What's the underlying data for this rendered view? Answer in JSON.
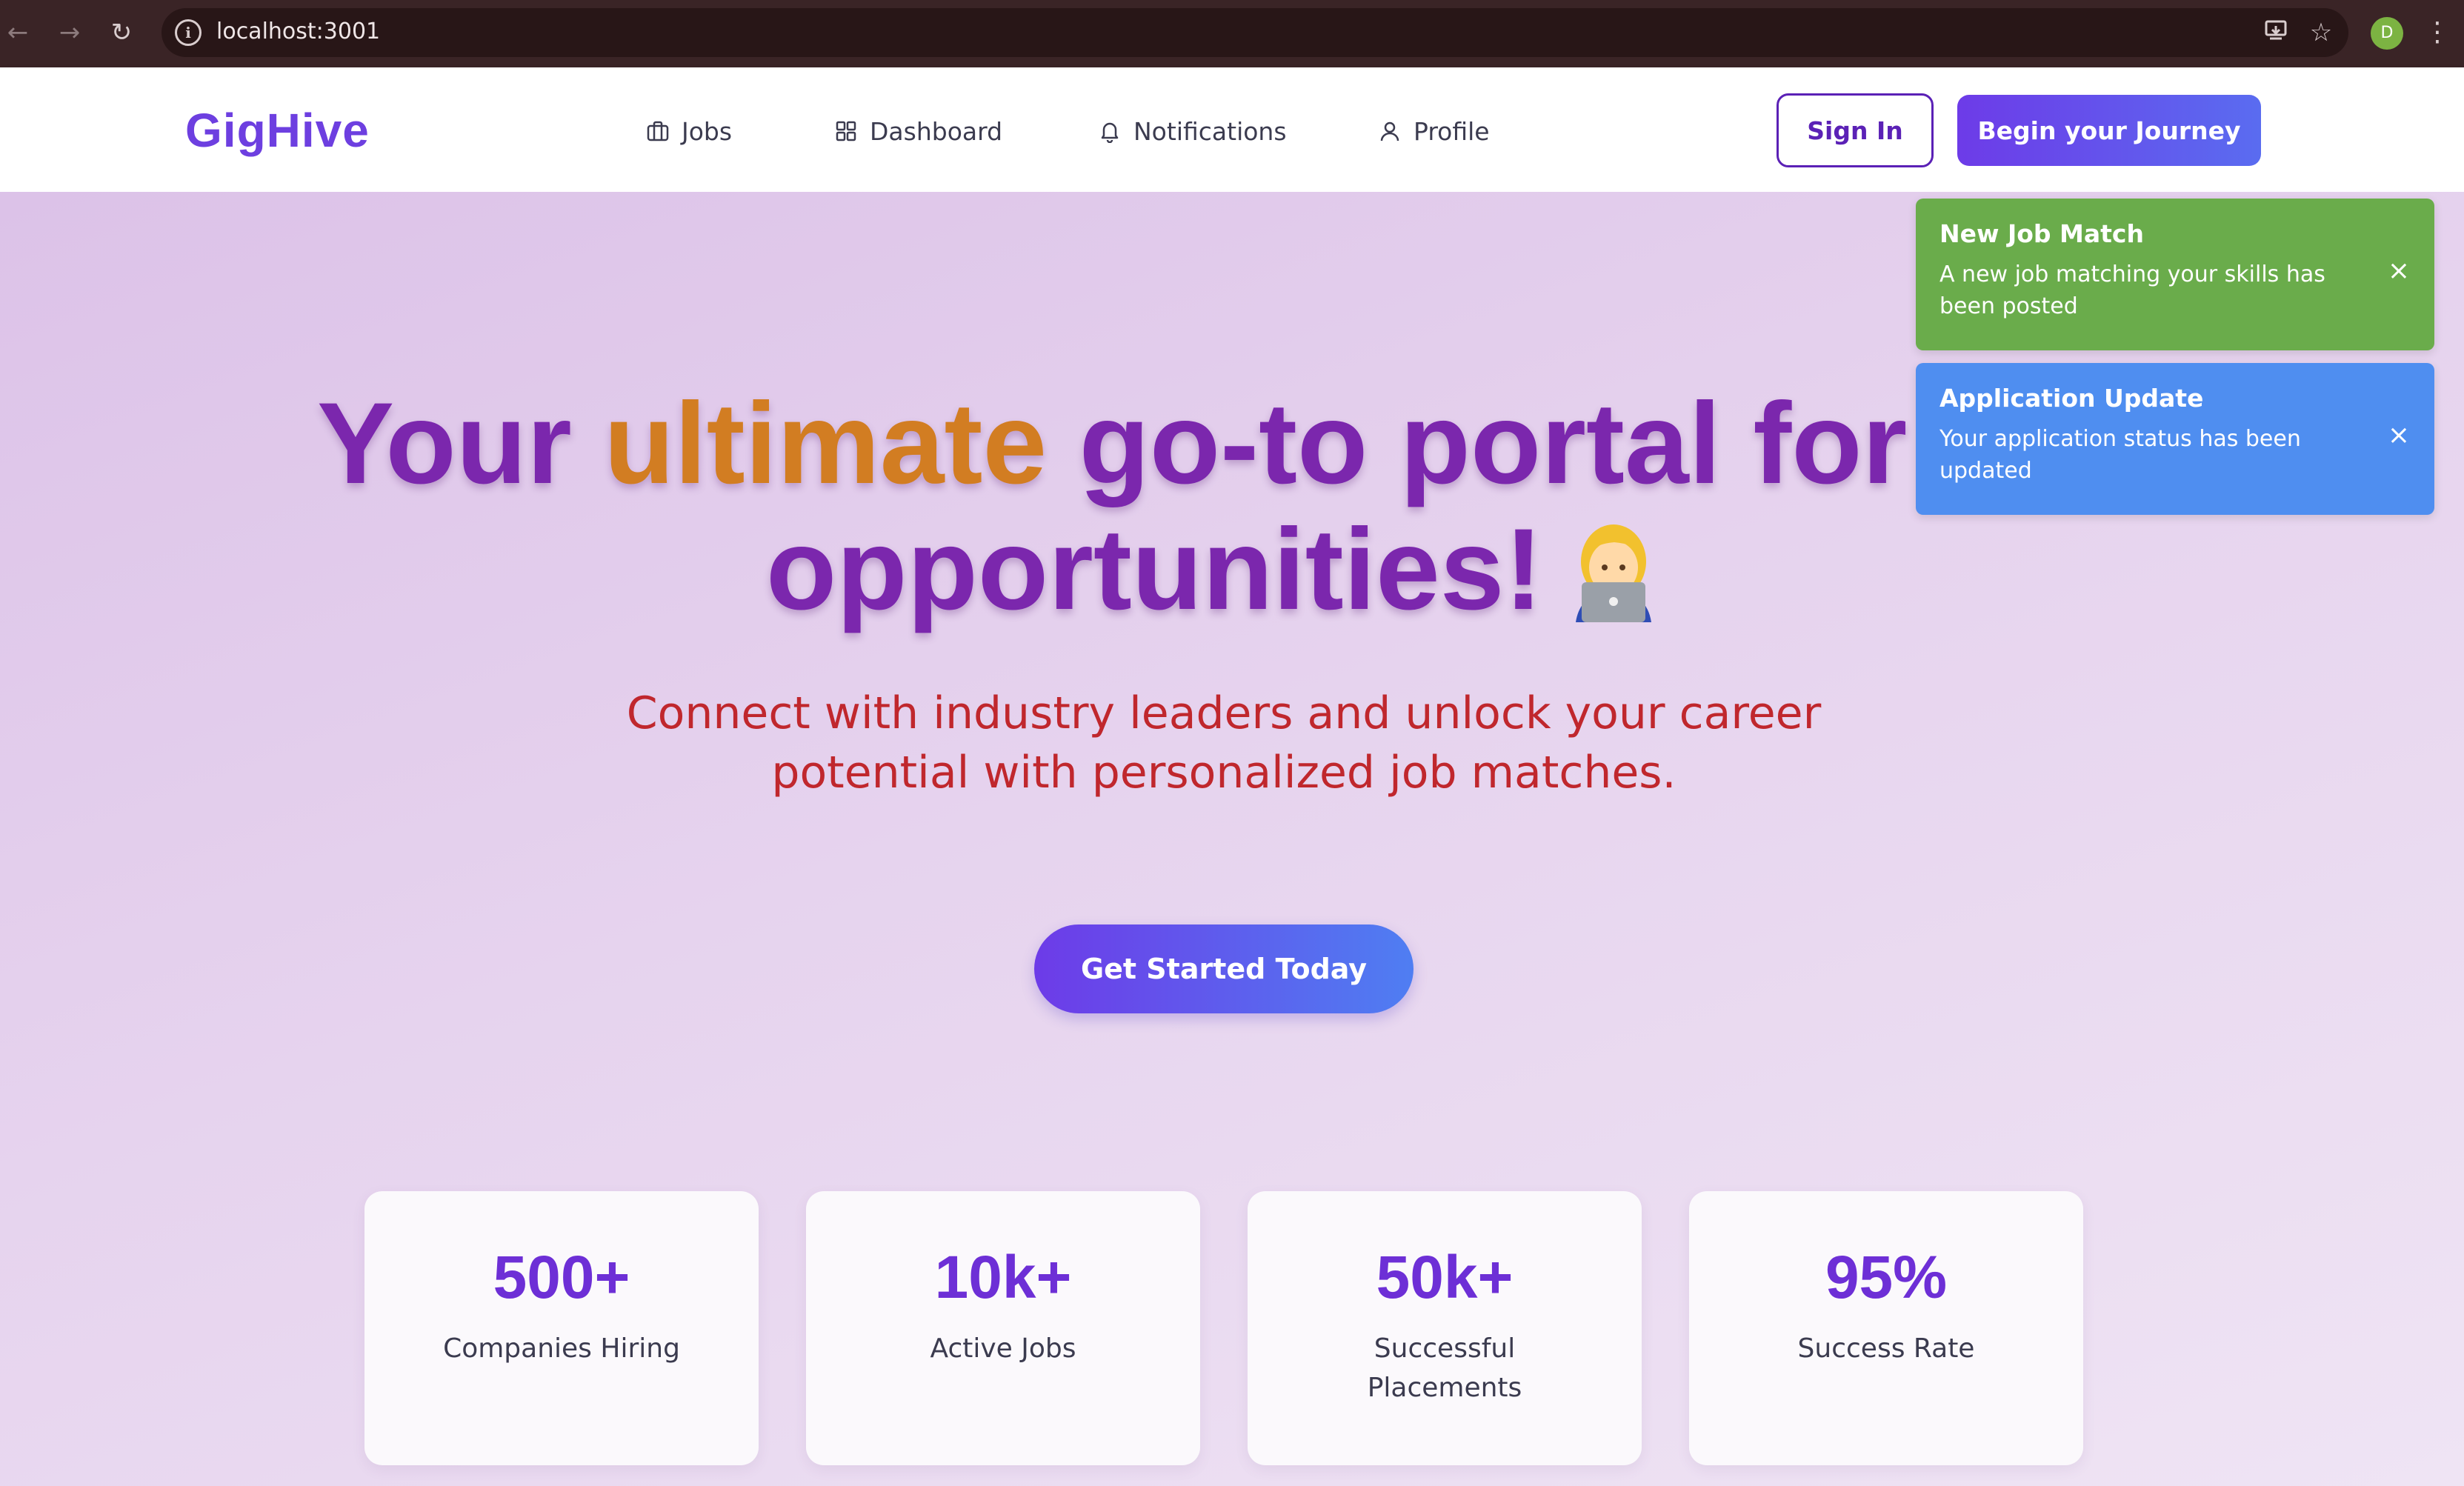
{
  "browser": {
    "url": "localhost:3001",
    "profile_initial": "D"
  },
  "header": {
    "logo": "GigHive",
    "nav": [
      {
        "label": "Jobs",
        "icon": "briefcase-icon"
      },
      {
        "label": "Dashboard",
        "icon": "grid-icon"
      },
      {
        "label": "Notifications",
        "icon": "bell-icon"
      },
      {
        "label": "Profile",
        "icon": "user-icon"
      }
    ],
    "sign_in": "Sign In",
    "begin": "Begin your Journey"
  },
  "hero": {
    "headline_part1": "Your ",
    "headline_accent": "ultimate",
    "headline_part2": " go-to portal for",
    "headline_line2": "opportunities!",
    "emoji": "woman-technologist-emoji",
    "subtitle_line1": "Connect with industry leaders and unlock your career",
    "subtitle_line2": "potential with personalized job matches.",
    "cta": "Get Started Today"
  },
  "stats": [
    {
      "value": "500+",
      "label": "Companies Hiring"
    },
    {
      "value": "10k+",
      "label": "Active Jobs"
    },
    {
      "value": "50k+",
      "label": "Successful Placements"
    },
    {
      "value": "95%",
      "label": "Success Rate"
    }
  ],
  "toasts": [
    {
      "title": "New Job Match",
      "message": "A new job matching your skills has been posted",
      "color": "#6aac4b"
    },
    {
      "title": "Application Update",
      "message": "Your application status has been updated",
      "color": "#4f8ef0"
    }
  ],
  "colors": {
    "brand": "#6d3fe0",
    "headline": "#7b27ad",
    "accent": "#d27d22",
    "subtitle": "#c0272d"
  }
}
